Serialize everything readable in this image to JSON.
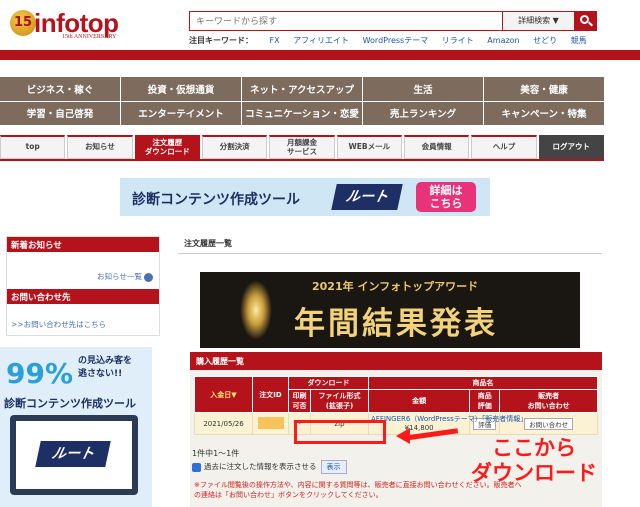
{
  "header": {
    "logo_main": "infotop",
    "logo_badge": "15",
    "logo_sub": "15th ANNIVERSARY",
    "search_placeholder": "キーワードから探す",
    "detail_search_label": "詳細検索 ▼",
    "keywords_label": "注目キーワード：",
    "keywords": [
      "FX",
      "アフィリエイト",
      "WordPressテーマ",
      "リライト",
      "Amazon",
      "せどり",
      "競馬"
    ]
  },
  "categories": [
    "ビジネス・稼ぐ",
    "投資・仮想通貨",
    "ネット・アクセスアップ",
    "生活",
    "美容・健康",
    "学習・自己啓発",
    "エンターテイメント",
    "コミュニケーション・恋愛",
    "売上ランキング",
    "キャンペーン・特集"
  ],
  "tabs": [
    {
      "label": "top"
    },
    {
      "label": "お知らせ"
    },
    {
      "label": "注文履歴\nダウンロード",
      "active": true
    },
    {
      "label": "分割決済"
    },
    {
      "label": "月額課金\nサービス"
    },
    {
      "label": "WEBメール"
    },
    {
      "label": "会員情報"
    },
    {
      "label": "ヘルプ"
    },
    {
      "label": "ログアウト",
      "logout": true
    }
  ],
  "banner": {
    "text": "診断コンテンツ作成ツール",
    "logo": "ルート",
    "button": "詳細は\nこちら"
  },
  "sidebar": {
    "news_head": "新着お知らせ",
    "news_link": "お知らせ一覧",
    "contact_head": "お問い合わせ先",
    "contact_link": ">>お問い合わせ先はこちら"
  },
  "promo": {
    "big": "99%",
    "sub1": "の見込み客を",
    "sub2": "逃さない!!",
    "title": "診断コンテンツ作成ツール",
    "logo": "ルート"
  },
  "main": {
    "order_title": "注文履歴一覧",
    "award_line1": "2021年 インフォトップアワード",
    "award_line2": "年間結果発表",
    "purchase_head": "購入履歴一覧",
    "headers": {
      "date": "入金日▼",
      "order_no": "注文ID",
      "download": "ダウンロード",
      "print": "印刷\n可否",
      "file_format": "ファイル形式\n(拡張子)",
      "product_name": "商品名",
      "amount": "金額",
      "product_review": "商品\n評価",
      "seller_contact": "販売者\nお問い合わせ"
    },
    "row": {
      "date": "2021/05/26",
      "print": "-",
      "file_format": "zip",
      "product": "AFFINGER6（WordPressテーマ）「販売者情報」",
      "amount": "¥14,800",
      "review_btn": "評価",
      "contact_btn": "お問い合わせ"
    },
    "count": "1件中1〜1件",
    "past_check": "過去に注文した情報を表示させる",
    "show_btn": "表示",
    "note": "※ファイル閲覧後の操作方法や、内容に関する質問等は、販売者に直接お問い合わせください。販売者への連絡は「お問い合わせ」ボタンをクリックしてください。",
    "annotation": "ここから\nダウンロード"
  },
  "colors": {
    "brand_red": "#b4131b",
    "category_brown": "#7d6b5d",
    "annotation_red": "#ff1a1a"
  }
}
